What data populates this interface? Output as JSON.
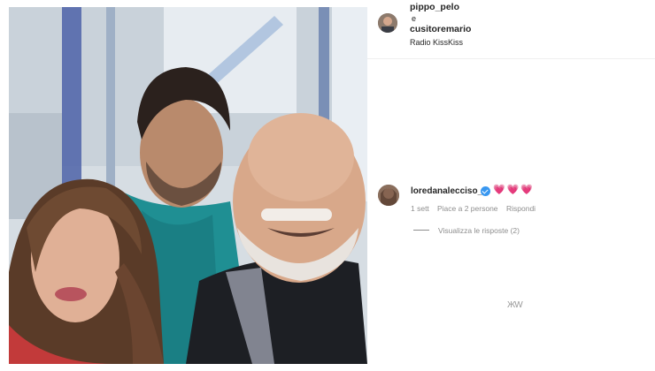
{
  "header": {
    "user1": "pippo_pelo",
    "amp": "e",
    "user2": "cusitoremario",
    "location": "Radio KissKiss"
  },
  "comment": {
    "username": "loredanalecciso_",
    "hearts": "💗💗💗",
    "time": "1 sett",
    "likes": "Piace a 2 persone",
    "reply": "Rispondi",
    "view_replies": "Visualizza le risposte (2)"
  },
  "scribble_text": "ЖW",
  "colors": {
    "verified": "#3897f0",
    "hearts": "#e4307a",
    "meta_text": "#8e8e8e"
  }
}
